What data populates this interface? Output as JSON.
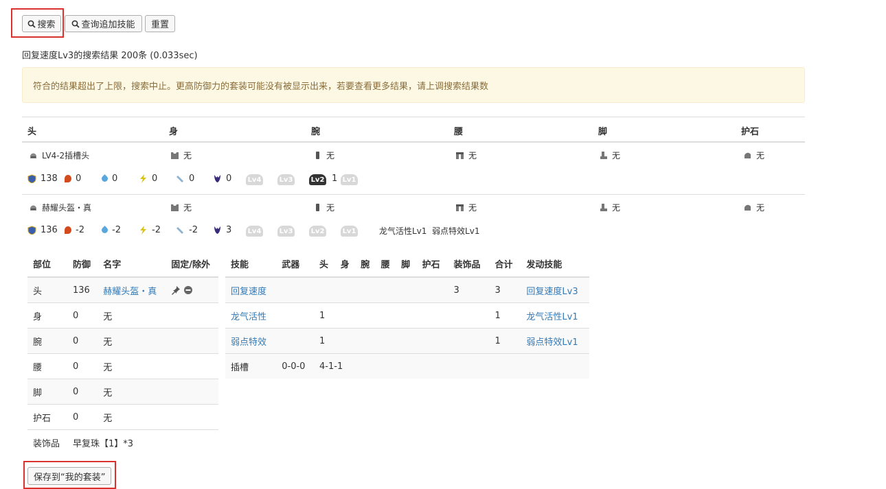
{
  "toolbar": {
    "search_label": "搜索",
    "query_extra_label": "查询追加技能",
    "reset_label": "重置"
  },
  "summary": "回复速度Lv3的搜索结果 200条 (0.033sec)",
  "alert": "符合的结果超出了上限，搜索中止。更高防御力的套装可能没有被显示出来，若要查看更多结果，请上调搜索结果数",
  "slots": [
    "头",
    "身",
    "腕",
    "腰",
    "脚",
    "护石"
  ],
  "results": [
    {
      "parts": [
        "LV4-2插槽头",
        "无",
        "无",
        "无",
        "无",
        "无"
      ],
      "defense": "138",
      "res": [
        "0",
        "0",
        "0",
        "0",
        "0"
      ],
      "lv": [
        "Lv4",
        "Lv3",
        "Lv2",
        "Lv1"
      ],
      "lv_active": 2,
      "lv2_count": "1",
      "skills": ""
    },
    {
      "parts": [
        "赫耀头盔・真",
        "无",
        "无",
        "无",
        "无",
        "无"
      ],
      "defense": "136",
      "res": [
        "-2",
        "-2",
        "-2",
        "-2",
        "3"
      ],
      "lv": [
        "Lv4",
        "Lv3",
        "Lv2",
        "Lv1"
      ],
      "lv_active": -1,
      "skills": "龙气活性Lv1  弱点特效Lv1"
    }
  ],
  "equip_table": {
    "headers": [
      "部位",
      "防御",
      "名字",
      "固定/除外"
    ],
    "rows": [
      [
        "头",
        "136",
        "赫耀头盔・真"
      ],
      [
        "身",
        "0",
        "无"
      ],
      [
        "腕",
        "0",
        "无"
      ],
      [
        "腰",
        "0",
        "无"
      ],
      [
        "脚",
        "0",
        "无"
      ],
      [
        "护石",
        "0",
        "无"
      ]
    ],
    "deco_label": "装饰品",
    "deco_value": "早复珠【1】*3"
  },
  "skill_table": {
    "headers": [
      "技能",
      "武器",
      "头",
      "身",
      "腕",
      "腰",
      "脚",
      "护石",
      "装饰品",
      "合计",
      "发动技能"
    ],
    "rows": [
      [
        "回复速度",
        "",
        "",
        "",
        "",
        "",
        "",
        "",
        "3",
        "3",
        "回复速度Lv3"
      ],
      [
        "龙气活性",
        "",
        "1",
        "",
        "",
        "",
        "",
        "",
        "",
        "1",
        "龙气活性Lv1"
      ],
      [
        "弱点特效",
        "",
        "1",
        "",
        "",
        "",
        "",
        "",
        "",
        "1",
        "弱点特效Lv1"
      ]
    ],
    "slot_label": "插槽",
    "slot_weapon": "0-0-0",
    "slot_armor": "4-1-1"
  },
  "save_label": "保存到“我的套装”",
  "colors": {
    "link": "#337ab7",
    "alert_bg": "#fcf8e3",
    "alert_text": "#8a6d3b",
    "highlight": "#d9312c"
  }
}
